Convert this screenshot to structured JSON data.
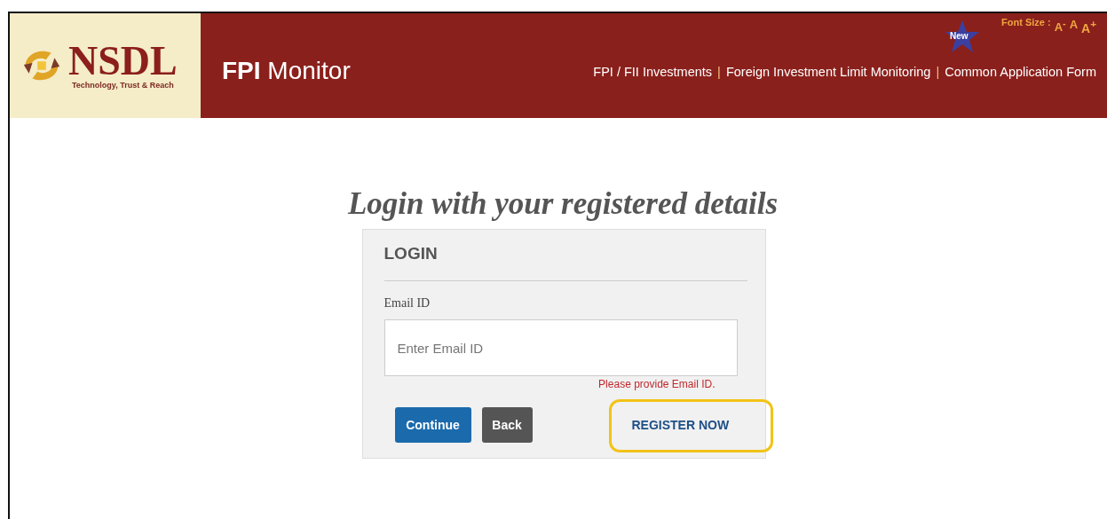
{
  "header": {
    "brand": "NSDL",
    "tagline": "Technology, Trust & Reach",
    "product_bold": "FPI",
    "product": "Monitor",
    "new_badge": "New",
    "font_size_label": "Font Size :",
    "font_sizes": [
      "A$^{-}$",
      "A",
      "A$^{+}$"
    ],
    "nav_separator": "|",
    "nav": [
      "FPI / FII Investments",
      "Foreign Investment Limit Monitoring",
      "Common Application Form"
    ]
  },
  "heading": "Login with your registered details",
  "login": {
    "title": "LOGIN",
    "email_label": "Email ID",
    "email_placeholder": "Enter Email ID",
    "error": "Please provide Email ID.",
    "buttons": [
      {
        "label": "Continue",
        "kind": "primary"
      },
      {
        "label": "Back",
        "kind": "secondary"
      }
    ],
    "register": {
      "label": "REGISTER NOW",
      "highlighted": true
    }
  }
}
